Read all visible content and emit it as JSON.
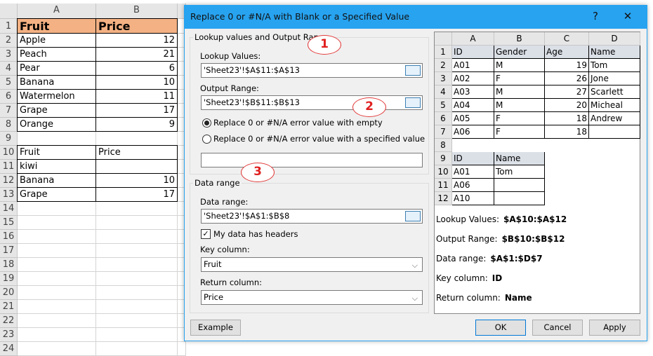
{
  "sheet": {
    "columns": [
      "A",
      "B"
    ],
    "rows": [
      {
        "n": "1",
        "a": "Fruit",
        "b": "Price"
      },
      {
        "n": "2",
        "a": "Apple",
        "b": "12"
      },
      {
        "n": "3",
        "a": "Peach",
        "b": "21"
      },
      {
        "n": "4",
        "a": "Pear",
        "b": "6"
      },
      {
        "n": "5",
        "a": "Banana",
        "b": "10"
      },
      {
        "n": "6",
        "a": "Watermelon",
        "b": "11"
      },
      {
        "n": "7",
        "a": "Grape",
        "b": "17"
      },
      {
        "n": "8",
        "a": "Orange",
        "b": "9"
      },
      {
        "n": "9",
        "a": "",
        "b": ""
      },
      {
        "n": "10",
        "a": "Fruit",
        "b": "Price"
      },
      {
        "n": "11",
        "a": "kiwi",
        "b": ""
      },
      {
        "n": "12",
        "a": "Banana",
        "b": "10"
      },
      {
        "n": "13",
        "a": "Grape",
        "b": "17"
      },
      {
        "n": "14",
        "a": "",
        "b": ""
      },
      {
        "n": "15",
        "a": "",
        "b": ""
      },
      {
        "n": "16",
        "a": "",
        "b": ""
      },
      {
        "n": "17",
        "a": "",
        "b": ""
      },
      {
        "n": "18",
        "a": "",
        "b": ""
      },
      {
        "n": "19",
        "a": "",
        "b": ""
      },
      {
        "n": "20",
        "a": "",
        "b": ""
      },
      {
        "n": "21",
        "a": "",
        "b": ""
      },
      {
        "n": "22",
        "a": "",
        "b": ""
      },
      {
        "n": "23",
        "a": "",
        "b": ""
      },
      {
        "n": "24",
        "a": "",
        "b": ""
      }
    ],
    "header_fill": "#f4b183"
  },
  "dialog": {
    "title": "Replace 0 or #N/A with Blank or a Specified Value",
    "help": "?",
    "close": "✕",
    "group1": {
      "legend": "Lookup values and Output Range",
      "lookup_label": "Lookup Values:",
      "lookup_value": "'Sheet23'!$A$11:$A$13",
      "output_label": "Output Range:",
      "output_value": "'Sheet23'!$B$11:$B$13",
      "radio_empty": "Replace 0 or  #N/A error value with empty",
      "radio_specified": "Replace 0 or  #N/A error value with a specified value",
      "radio_selected": "empty",
      "specified_value": ""
    },
    "group2": {
      "legend": "Data range",
      "range_label": "Data range:",
      "range_value": "'Sheet23'!$A$1:$B$8",
      "headers_label": "My data has headers",
      "headers_checked": true,
      "key_label": "Key column:",
      "key_value": "Fruit",
      "return_label": "Return column:",
      "return_value": "Price"
    },
    "buttons": {
      "example": "Example",
      "ok": "OK",
      "cancel": "Cancel",
      "apply": "Apply"
    },
    "callouts": [
      "1",
      "2",
      "3"
    ],
    "preview": {
      "columns": [
        "A",
        "B",
        "C",
        "D"
      ],
      "rows": [
        {
          "n": "1",
          "c": [
            "ID",
            "Gender",
            "Age",
            "Name"
          ]
        },
        {
          "n": "2",
          "c": [
            "A01",
            "M",
            "19",
            "Tom"
          ]
        },
        {
          "n": "3",
          "c": [
            "A02",
            "F",
            "26",
            "Jone"
          ]
        },
        {
          "n": "4",
          "c": [
            "A03",
            "M",
            "27",
            "Scarlett"
          ]
        },
        {
          "n": "5",
          "c": [
            "A04",
            "M",
            "20",
            "Micheal"
          ]
        },
        {
          "n": "6",
          "c": [
            "A05",
            "F",
            "18",
            "Andrew"
          ]
        },
        {
          "n": "7",
          "c": [
            "A06",
            "F",
            "18",
            ""
          ]
        },
        {
          "n": "8",
          "c": []
        },
        {
          "n": "9",
          "c": [
            "ID",
            "Name"
          ]
        },
        {
          "n": "10",
          "c": [
            "A01",
            "Tom"
          ]
        },
        {
          "n": "11",
          "c": [
            "A06",
            ""
          ]
        },
        {
          "n": "12",
          "c": [
            "A10",
            ""
          ]
        }
      ],
      "notes": [
        {
          "label": "Lookup Values:",
          "value": "$A$10:$A$12"
        },
        {
          "label": "Output Range:",
          "value": "$B$10:$B$12"
        },
        {
          "label": "Data range:",
          "value": "$A$1:$D$7"
        },
        {
          "label": "Key column:",
          "value": "ID"
        },
        {
          "label": "Return column:",
          "value": "Name"
        }
      ]
    }
  },
  "colors": {
    "titlebar": "#27a3f0",
    "callout": "#e23b3b"
  }
}
